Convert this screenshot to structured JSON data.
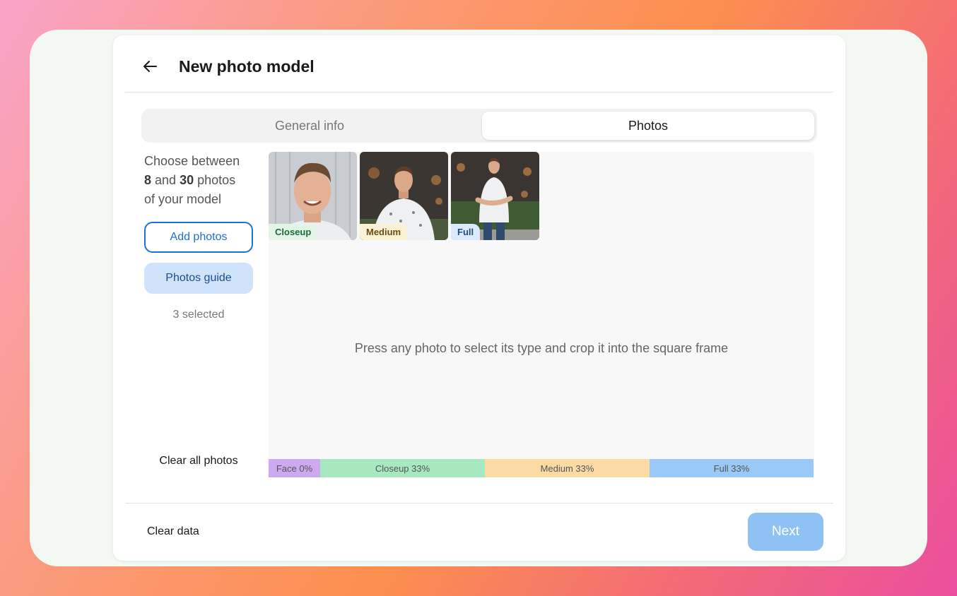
{
  "header": {
    "title": "New photo model",
    "back_icon": "arrow-left-icon"
  },
  "tabs": [
    {
      "label": "General info",
      "active": false
    },
    {
      "label": "Photos",
      "active": true
    }
  ],
  "sidebar": {
    "instruction_prefix": "Choose between",
    "min_photos": "8",
    "instruction_and": "and",
    "max_photos": "30",
    "instruction_suffix_1": "photos",
    "instruction_suffix_2": "of your model",
    "add_photos_label": "Add photos",
    "photos_guide_label": "Photos guide",
    "selected_count": "3 selected",
    "clear_all_label": "Clear all photos"
  },
  "photos": [
    {
      "type": "Closeup",
      "badge_color": "#e3f5e7",
      "badge_text_color": "#1d6b3a"
    },
    {
      "type": "Medium",
      "badge_color": "#fbf2d6",
      "badge_text_color": "#6a4d12"
    },
    {
      "type": "Full",
      "badge_color": "#dcebfb",
      "badge_text_color": "#1e4d86"
    }
  ],
  "hint": "Press any photo to select its type and crop it into the square frame",
  "distribution": [
    {
      "label": "Face 0%",
      "fraction": 0.095,
      "color": "#cdaaf0"
    },
    {
      "label": "Closeup 33%",
      "fraction": 0.302,
      "color": "#a6e9c1"
    },
    {
      "label": "Medium 33%",
      "fraction": 0.302,
      "color": "#fbdaa4"
    },
    {
      "label": "Full 33%",
      "fraction": 0.301,
      "color": "#9ac8f7"
    }
  ],
  "footer": {
    "clear_data_label": "Clear data",
    "next_label": "Next"
  }
}
